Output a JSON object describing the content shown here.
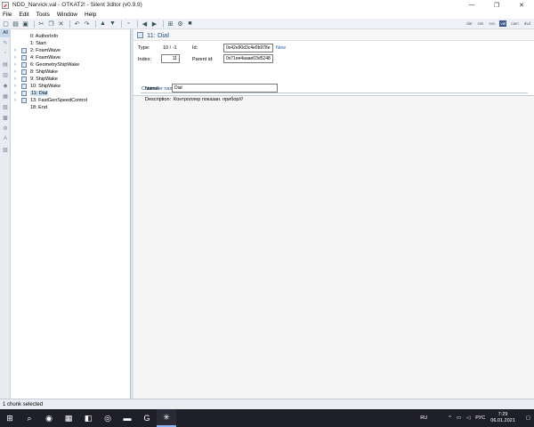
{
  "window": {
    "title": "NDD_Narvick.val - OTKAT2! - Silent 3ditor (v0.9.9)",
    "minimize_glyph": "—",
    "maximize_glyph": "❐",
    "close_glyph": "✕"
  },
  "menu": [
    "File",
    "Edit",
    "Tools",
    "Window",
    "Help"
  ],
  "toolbar": {
    "buttons": [
      {
        "icon": "new-file-icon",
        "glyph": "▢"
      },
      {
        "icon": "open-folder-icon",
        "glyph": "▤"
      },
      {
        "icon": "save-icon",
        "glyph": "▣"
      },
      {
        "icon": "cut-icon",
        "glyph": "✂"
      },
      {
        "icon": "copy-icon",
        "glyph": "❐"
      },
      {
        "icon": "delete-icon",
        "glyph": "✕"
      },
      {
        "icon": "undo-icon",
        "glyph": "↶"
      },
      {
        "icon": "redo-icon",
        "glyph": "↷"
      },
      {
        "icon": "move-up-icon",
        "glyph": "▲"
      },
      {
        "icon": "move-down-icon",
        "glyph": "▼"
      },
      {
        "icon": "disabled-icon",
        "glyph": "▫"
      },
      {
        "icon": "back-icon",
        "glyph": "◀"
      },
      {
        "icon": "forward-icon",
        "glyph": "▶"
      },
      {
        "icon": "grid-icon",
        "glyph": "⊞"
      },
      {
        "icon": "gear-icon",
        "glyph": "⚙"
      },
      {
        "icon": "camera-icon",
        "glyph": "■"
      }
    ],
    "ext_tabs": [
      "dat",
      "sim",
      "scn",
      "val",
      "cam",
      "dvd"
    ],
    "active_ext_tab": "val"
  },
  "icon_strip": {
    "all_label": "All",
    "icons": [
      "✎",
      "▫",
      "▤",
      "▥",
      "◆",
      "▦",
      "▧",
      "▩",
      "⚙",
      "A",
      "▨"
    ]
  },
  "tree": {
    "items": [
      {
        "label": "0: AuthorInfo",
        "expander": "",
        "has_icon": false,
        "selected": false
      },
      {
        "label": "1: Start",
        "expander": "",
        "has_icon": false,
        "selected": false
      },
      {
        "label": "2: FoamWave",
        "expander": "›",
        "has_icon": true,
        "selected": false
      },
      {
        "label": "4: FoamWave",
        "expander": "›",
        "has_icon": true,
        "selected": false
      },
      {
        "label": "6: GeometryShipWake",
        "expander": "›",
        "has_icon": true,
        "selected": false
      },
      {
        "label": "8: ShipWake",
        "expander": "›",
        "has_icon": true,
        "selected": false
      },
      {
        "label": "9: ShipWake",
        "expander": "›",
        "has_icon": true,
        "selected": false
      },
      {
        "label": "10: ShipWake",
        "expander": "›",
        "has_icon": true,
        "selected": false
      },
      {
        "label": "11: Dial",
        "expander": "›",
        "has_icon": true,
        "selected": true
      },
      {
        "label": "13: FastGenSpeedControl",
        "expander": "›",
        "has_icon": true,
        "selected": false
      },
      {
        "label": "18: End",
        "expander": "",
        "has_icon": false,
        "selected": false
      }
    ]
  },
  "header": {
    "title": "11: Dial"
  },
  "info": {
    "type_label": "Type:",
    "type_value": "10 / -1",
    "id_label": "Id:",
    "id_value": "0x42e90d3c4e0b978e",
    "new_link": "New",
    "index_label": "Index:",
    "index_value": "11",
    "parent_id_label": "Parent id:",
    "parent_id_value": "0x71ee4aaae03d5248"
  },
  "controller": {
    "section_title": "Controller name",
    "name_label": "Name:",
    "name_value": "Dial",
    "description_label": "Description:",
    "description_value": "Контроллер показан. прибор///"
  },
  "status": {
    "text": "1 chunk selected"
  },
  "taskbar": {
    "apps": [
      {
        "icon": "windows-start-icon",
        "glyph": "⊞"
      },
      {
        "icon": "search-icon",
        "glyph": "⌕"
      },
      {
        "icon": "chrome-icon",
        "glyph": "◉"
      },
      {
        "icon": "terminal-icon",
        "glyph": "▦"
      },
      {
        "icon": "media-icon",
        "glyph": "◧"
      },
      {
        "icon": "steam-icon",
        "glyph": "◎"
      },
      {
        "icon": "folder-icon",
        "glyph": "▬"
      },
      {
        "icon": "g-app-icon",
        "glyph": "G"
      },
      {
        "icon": "editor-app-icon",
        "glyph": "✳"
      }
    ],
    "language_left": "RU",
    "language_right": "РУС",
    "time": "7:29",
    "date": "06.01.2021"
  },
  "colors": {
    "accent": "#1f4e8c",
    "selection": "#cce4f7",
    "link": "#1f5fbf",
    "taskbar": "#1f1f2a"
  }
}
